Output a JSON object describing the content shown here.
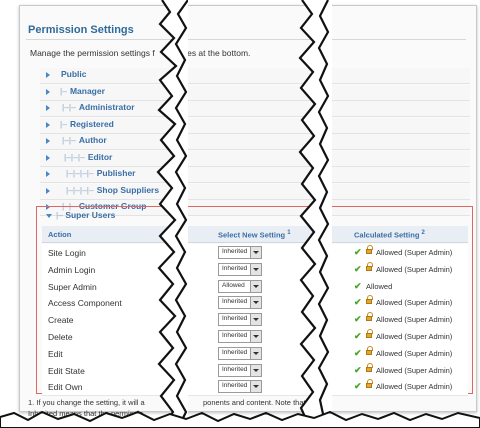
{
  "panel": {
    "title": "Permission Settings",
    "description_left": "Manage the permission settings f",
    "description_right": "otes at the bottom."
  },
  "groups": [
    {
      "label": "Public",
      "prefix": ""
    },
    {
      "label": "Manager",
      "prefix": "|–"
    },
    {
      "label": "Administrator",
      "prefix": "|–|–"
    },
    {
      "label": "Registered",
      "prefix": "|–"
    },
    {
      "label": "Author",
      "prefix": "|–|–"
    },
    {
      "label": "Editor",
      "prefix": "|–|–|–"
    },
    {
      "label": "Publisher",
      "prefix": "|–|–|–|–"
    },
    {
      "label": "Shop Suppliers",
      "prefix": "|–|–|–|–"
    },
    {
      "label": "Customer Group",
      "prefix": "|–|–"
    }
  ],
  "super_users": {
    "prefix": "|–",
    "label": "Super Users"
  },
  "table": {
    "col_action": "Action",
    "col_select": "Select New Setting",
    "col_select_note": "1",
    "col_calc": "Calculated Setting",
    "col_calc_note": "2",
    "rows": [
      {
        "action": "Site Login",
        "setting": "Inherited",
        "calc": "Allowed (Super Admin)",
        "locked": true
      },
      {
        "action": "Admin Login",
        "setting": "Inherited",
        "calc": "Allowed (Super Admin)",
        "locked": true
      },
      {
        "action": "Super Admin",
        "setting": "Allowed",
        "calc": "Allowed",
        "locked": false
      },
      {
        "action": "Access Component",
        "setting": "Inherited",
        "calc": "Allowed (Super Admin)",
        "locked": true
      },
      {
        "action": "Create",
        "setting": "Inherited",
        "calc": "Allowed (Super Admin)",
        "locked": true
      },
      {
        "action": "Delete",
        "setting": "Inherited",
        "calc": "Allowed (Super Admin)",
        "locked": true
      },
      {
        "action": "Edit",
        "setting": "Inherited",
        "calc": "Allowed (Super Admin)",
        "locked": true
      },
      {
        "action": "Edit State",
        "setting": "Inherited",
        "calc": "Allowed (Super Admin)",
        "locked": true
      },
      {
        "action": "Edit Own",
        "setting": "Inherited",
        "calc": "Allowed (Super Admin)",
        "locked": true
      }
    ]
  },
  "footnotes": {
    "line1_left": "1. If you change the setting, it will a",
    "line1_mid": "ponents and content. Note that:",
    "line2_left": "Inherited means that the permissio",
    "line2_mid": ""
  },
  "colors": {
    "accent": "#3a6ea5",
    "title": "#2f6b9a",
    "highlight_border": "#e06666",
    "allowed_check": "#4aa42a",
    "lock": "#e2a72b"
  }
}
